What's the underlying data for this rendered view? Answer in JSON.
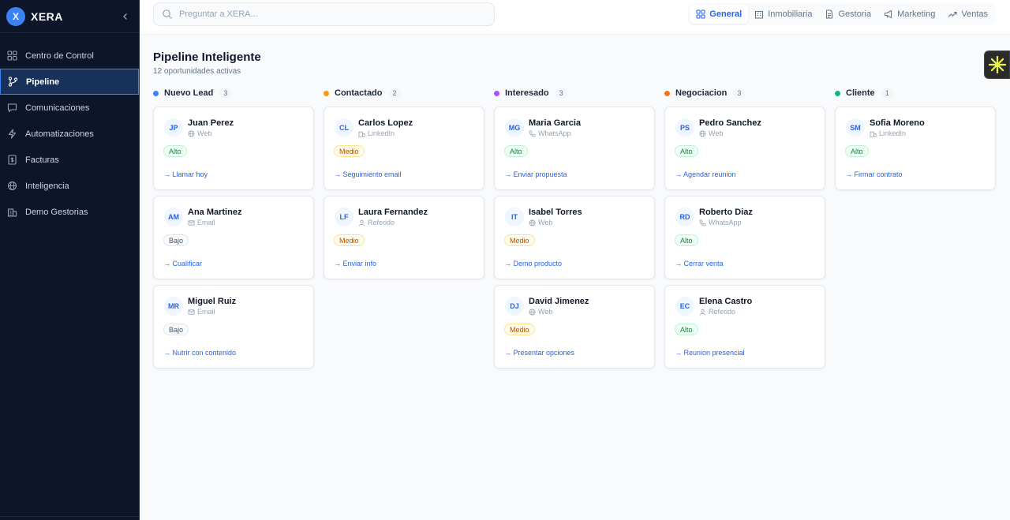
{
  "app": {
    "logo_letter": "X",
    "name": "XERA"
  },
  "sidebar": {
    "items": [
      {
        "label": "Centro de Control",
        "icon": "grid-icon",
        "active": false
      },
      {
        "label": "Pipeline",
        "icon": "branch-icon",
        "active": true
      },
      {
        "label": "Comunicaciones",
        "icon": "chat-icon",
        "active": false
      },
      {
        "label": "Automatizaciones",
        "icon": "bolt-icon",
        "active": false
      },
      {
        "label": "Facturas",
        "icon": "invoice-icon",
        "active": false
      },
      {
        "label": "Inteligencia",
        "icon": "globe-icon",
        "active": false
      },
      {
        "label": "Demo Gestorias",
        "icon": "building-icon",
        "active": false
      }
    ]
  },
  "search": {
    "placeholder": "Preguntar a XERA..."
  },
  "tabs": [
    {
      "label": "General",
      "icon": "grid-icon",
      "active": true
    },
    {
      "label": "Inmobiliaria",
      "icon": "building-icon",
      "active": false
    },
    {
      "label": "Gestoria",
      "icon": "document-icon",
      "active": false
    },
    {
      "label": "Marketing",
      "icon": "megaphone-icon",
      "active": false
    },
    {
      "label": "Ventas",
      "icon": "trend-icon",
      "active": false
    }
  ],
  "page": {
    "title": "Pipeline Inteligente",
    "subtitle": "12 oportunidades activas"
  },
  "columns": [
    {
      "title": "Nuevo Lead",
      "count": "3",
      "color": "#3b82f6",
      "cards": [
        {
          "initials": "JP",
          "name": "Juan Perez",
          "source": "Web",
          "source_icon": "globe-icon",
          "priority": "Alto",
          "action": "→ Llamar hoy"
        },
        {
          "initials": "AM",
          "name": "Ana Martinez",
          "source": "Email",
          "source_icon": "mail-icon",
          "priority": "Bajo",
          "action": "→ Cualificar"
        },
        {
          "initials": "MR",
          "name": "Miguel Ruiz",
          "source": "Email",
          "source_icon": "mail-icon",
          "priority": "Bajo",
          "action": "→ Nutrir con contenido"
        }
      ]
    },
    {
      "title": "Contactado",
      "count": "2",
      "color": "#f59e0b",
      "cards": [
        {
          "initials": "CL",
          "name": "Carlos Lopez",
          "source": "LinkedIn",
          "source_icon": "building-icon",
          "priority": "Medio",
          "action": "→ Seguimiento email"
        },
        {
          "initials": "LF",
          "name": "Laura Fernandez",
          "source": "Referido",
          "source_icon": "user-icon",
          "priority": "Medio",
          "action": "→ Enviar info"
        }
      ]
    },
    {
      "title": "Interesado",
      "count": "3",
      "color": "#a855f7",
      "cards": [
        {
          "initials": "MG",
          "name": "Maria Garcia",
          "source": "WhatsApp",
          "source_icon": "phone-icon",
          "priority": "Alto",
          "action": "→ Enviar propuesta"
        },
        {
          "initials": "IT",
          "name": "Isabel Torres",
          "source": "Web",
          "source_icon": "globe-icon",
          "priority": "Medio",
          "action": "→ Demo producto"
        },
        {
          "initials": "DJ",
          "name": "David Jimenez",
          "source": "Web",
          "source_icon": "globe-icon",
          "priority": "Medio",
          "action": "→ Presentar opciones"
        }
      ]
    },
    {
      "title": "Negociacion",
      "count": "3",
      "color": "#f97316",
      "cards": [
        {
          "initials": "PS",
          "name": "Pedro Sanchez",
          "source": "Web",
          "source_icon": "globe-icon",
          "priority": "Alto",
          "action": "→ Agendar reunion"
        },
        {
          "initials": "RD",
          "name": "Roberto Diaz",
          "source": "WhatsApp",
          "source_icon": "phone-icon",
          "priority": "Alto",
          "action": "→ Cerrar venta"
        },
        {
          "initials": "EC",
          "name": "Elena Castro",
          "source": "Referido",
          "source_icon": "user-icon",
          "priority": "Alto",
          "action": "→ Reunion presencial"
        }
      ]
    },
    {
      "title": "Cliente",
      "count": "1",
      "color": "#10b981",
      "cards": [
        {
          "initials": "SM",
          "name": "Sofia Moreno",
          "source": "LinkedIn",
          "source_icon": "building-icon",
          "priority": "Alto",
          "action": "→ Firmar contrato"
        }
      ]
    }
  ]
}
